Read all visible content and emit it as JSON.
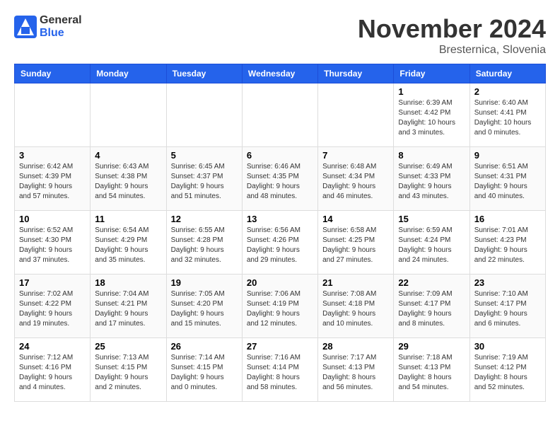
{
  "header": {
    "logo_general": "General",
    "logo_blue": "Blue",
    "month_title": "November 2024",
    "location": "Bresternica, Slovenia"
  },
  "weekdays": [
    "Sunday",
    "Monday",
    "Tuesday",
    "Wednesday",
    "Thursday",
    "Friday",
    "Saturday"
  ],
  "weeks": [
    [
      {
        "day": "",
        "detail": ""
      },
      {
        "day": "",
        "detail": ""
      },
      {
        "day": "",
        "detail": ""
      },
      {
        "day": "",
        "detail": ""
      },
      {
        "day": "",
        "detail": ""
      },
      {
        "day": "1",
        "detail": "Sunrise: 6:39 AM\nSunset: 4:42 PM\nDaylight: 10 hours\nand 3 minutes."
      },
      {
        "day": "2",
        "detail": "Sunrise: 6:40 AM\nSunset: 4:41 PM\nDaylight: 10 hours\nand 0 minutes."
      }
    ],
    [
      {
        "day": "3",
        "detail": "Sunrise: 6:42 AM\nSunset: 4:39 PM\nDaylight: 9 hours\nand 57 minutes."
      },
      {
        "day": "4",
        "detail": "Sunrise: 6:43 AM\nSunset: 4:38 PM\nDaylight: 9 hours\nand 54 minutes."
      },
      {
        "day": "5",
        "detail": "Sunrise: 6:45 AM\nSunset: 4:37 PM\nDaylight: 9 hours\nand 51 minutes."
      },
      {
        "day": "6",
        "detail": "Sunrise: 6:46 AM\nSunset: 4:35 PM\nDaylight: 9 hours\nand 48 minutes."
      },
      {
        "day": "7",
        "detail": "Sunrise: 6:48 AM\nSunset: 4:34 PM\nDaylight: 9 hours\nand 46 minutes."
      },
      {
        "day": "8",
        "detail": "Sunrise: 6:49 AM\nSunset: 4:33 PM\nDaylight: 9 hours\nand 43 minutes."
      },
      {
        "day": "9",
        "detail": "Sunrise: 6:51 AM\nSunset: 4:31 PM\nDaylight: 9 hours\nand 40 minutes."
      }
    ],
    [
      {
        "day": "10",
        "detail": "Sunrise: 6:52 AM\nSunset: 4:30 PM\nDaylight: 9 hours\nand 37 minutes."
      },
      {
        "day": "11",
        "detail": "Sunrise: 6:54 AM\nSunset: 4:29 PM\nDaylight: 9 hours\nand 35 minutes."
      },
      {
        "day": "12",
        "detail": "Sunrise: 6:55 AM\nSunset: 4:28 PM\nDaylight: 9 hours\nand 32 minutes."
      },
      {
        "day": "13",
        "detail": "Sunrise: 6:56 AM\nSunset: 4:26 PM\nDaylight: 9 hours\nand 29 minutes."
      },
      {
        "day": "14",
        "detail": "Sunrise: 6:58 AM\nSunset: 4:25 PM\nDaylight: 9 hours\nand 27 minutes."
      },
      {
        "day": "15",
        "detail": "Sunrise: 6:59 AM\nSunset: 4:24 PM\nDaylight: 9 hours\nand 24 minutes."
      },
      {
        "day": "16",
        "detail": "Sunrise: 7:01 AM\nSunset: 4:23 PM\nDaylight: 9 hours\nand 22 minutes."
      }
    ],
    [
      {
        "day": "17",
        "detail": "Sunrise: 7:02 AM\nSunset: 4:22 PM\nDaylight: 9 hours\nand 19 minutes."
      },
      {
        "day": "18",
        "detail": "Sunrise: 7:04 AM\nSunset: 4:21 PM\nDaylight: 9 hours\nand 17 minutes."
      },
      {
        "day": "19",
        "detail": "Sunrise: 7:05 AM\nSunset: 4:20 PM\nDaylight: 9 hours\nand 15 minutes."
      },
      {
        "day": "20",
        "detail": "Sunrise: 7:06 AM\nSunset: 4:19 PM\nDaylight: 9 hours\nand 12 minutes."
      },
      {
        "day": "21",
        "detail": "Sunrise: 7:08 AM\nSunset: 4:18 PM\nDaylight: 9 hours\nand 10 minutes."
      },
      {
        "day": "22",
        "detail": "Sunrise: 7:09 AM\nSunset: 4:17 PM\nDaylight: 9 hours\nand 8 minutes."
      },
      {
        "day": "23",
        "detail": "Sunrise: 7:10 AM\nSunset: 4:17 PM\nDaylight: 9 hours\nand 6 minutes."
      }
    ],
    [
      {
        "day": "24",
        "detail": "Sunrise: 7:12 AM\nSunset: 4:16 PM\nDaylight: 9 hours\nand 4 minutes."
      },
      {
        "day": "25",
        "detail": "Sunrise: 7:13 AM\nSunset: 4:15 PM\nDaylight: 9 hours\nand 2 minutes."
      },
      {
        "day": "26",
        "detail": "Sunrise: 7:14 AM\nSunset: 4:15 PM\nDaylight: 9 hours\nand 0 minutes."
      },
      {
        "day": "27",
        "detail": "Sunrise: 7:16 AM\nSunset: 4:14 PM\nDaylight: 8 hours\nand 58 minutes."
      },
      {
        "day": "28",
        "detail": "Sunrise: 7:17 AM\nSunset: 4:13 PM\nDaylight: 8 hours\nand 56 minutes."
      },
      {
        "day": "29",
        "detail": "Sunrise: 7:18 AM\nSunset: 4:13 PM\nDaylight: 8 hours\nand 54 minutes."
      },
      {
        "day": "30",
        "detail": "Sunrise: 7:19 AM\nSunset: 4:12 PM\nDaylight: 8 hours\nand 52 minutes."
      }
    ]
  ]
}
